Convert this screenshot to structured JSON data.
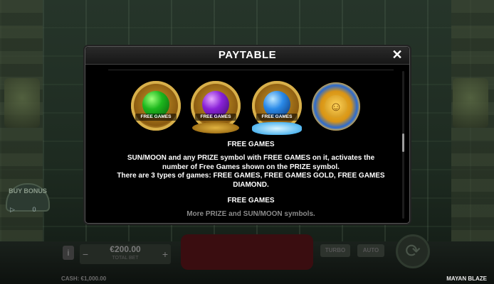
{
  "modal": {
    "title": "PAYTABLE",
    "close_glyph": "✕",
    "symbols": [
      {
        "name": "green-prize-orb",
        "label": "FREE GAMES",
        "color": "#1db81d"
      },
      {
        "name": "purple-prize-orb",
        "label": "FREE GAMES",
        "color": "#8a22d8"
      },
      {
        "name": "blue-prize-orb",
        "label": "FREE GAMES",
        "color": "#2a8ae8"
      },
      {
        "name": "sun-moon-symbol",
        "icon": "sun-moon-icon"
      }
    ],
    "section_heading": "FREE GAMES",
    "paragraph_1": "SUN/MOON and any PRIZE symbol with FREE GAMES on it, activates the number of Free Games shown on the PRIZE symbol.",
    "paragraph_2": "There are 3 types of games: FREE GAMES, FREE GAMES GOLD, FREE GAMES DIAMOND.",
    "section_heading_2": "FREE GAMES",
    "faded_line": "More PRIZE and SUN/MOON symbols."
  },
  "background": {
    "bonus_label": "BUY BONUS",
    "bonus_count": "0",
    "info_label": "i",
    "bet_value": "€200.00",
    "bet_label": "TOTAL BET",
    "turbo_label": "TURBO",
    "auto_label": "AUTO",
    "cash": "CASH: €1,000.00",
    "game_name": "MAYAN BLAZE"
  },
  "colors": {
    "modal_bg": "#000000",
    "title_text": "#ffffff",
    "gold": "#d8b04a"
  }
}
